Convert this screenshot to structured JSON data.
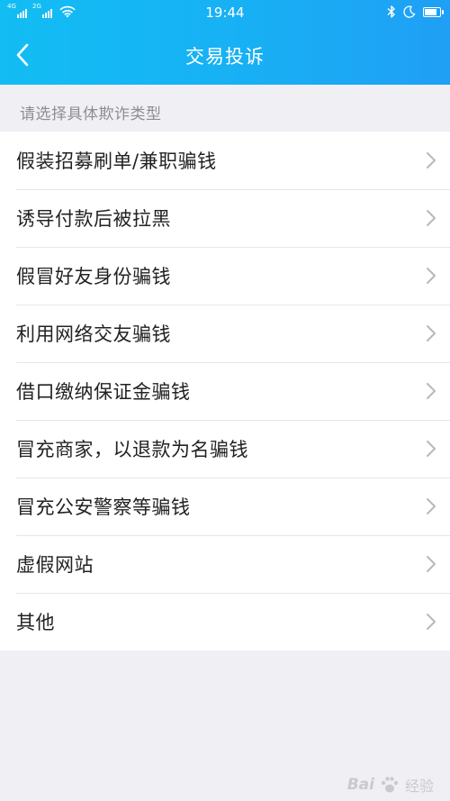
{
  "status_bar": {
    "network_left": "4G",
    "network_right": "2G",
    "time": "19:44",
    "icons": [
      "signal-icon",
      "signal-icon",
      "wifi-icon",
      "bluetooth-icon",
      "moon-icon",
      "battery-icon"
    ]
  },
  "header": {
    "title": "交易投诉",
    "background_colors": [
      "#12bdf3",
      "#1f9ff5"
    ]
  },
  "section": {
    "label": "请选择具体欺诈类型"
  },
  "items": [
    {
      "label": "假装招募刷单/兼职骗钱"
    },
    {
      "label": "诱导付款后被拉黑"
    },
    {
      "label": "假冒好友身份骗钱"
    },
    {
      "label": "利用网络交友骗钱"
    },
    {
      "label": "借口缴纳保证金骗钱"
    },
    {
      "label": "冒充商家，以退款为名骗钱"
    },
    {
      "label": "冒充公安警察等骗钱"
    },
    {
      "label": "虚假网站"
    },
    {
      "label": "其他"
    }
  ],
  "watermark": {
    "brand": "Bai",
    "suffix": "经验"
  }
}
